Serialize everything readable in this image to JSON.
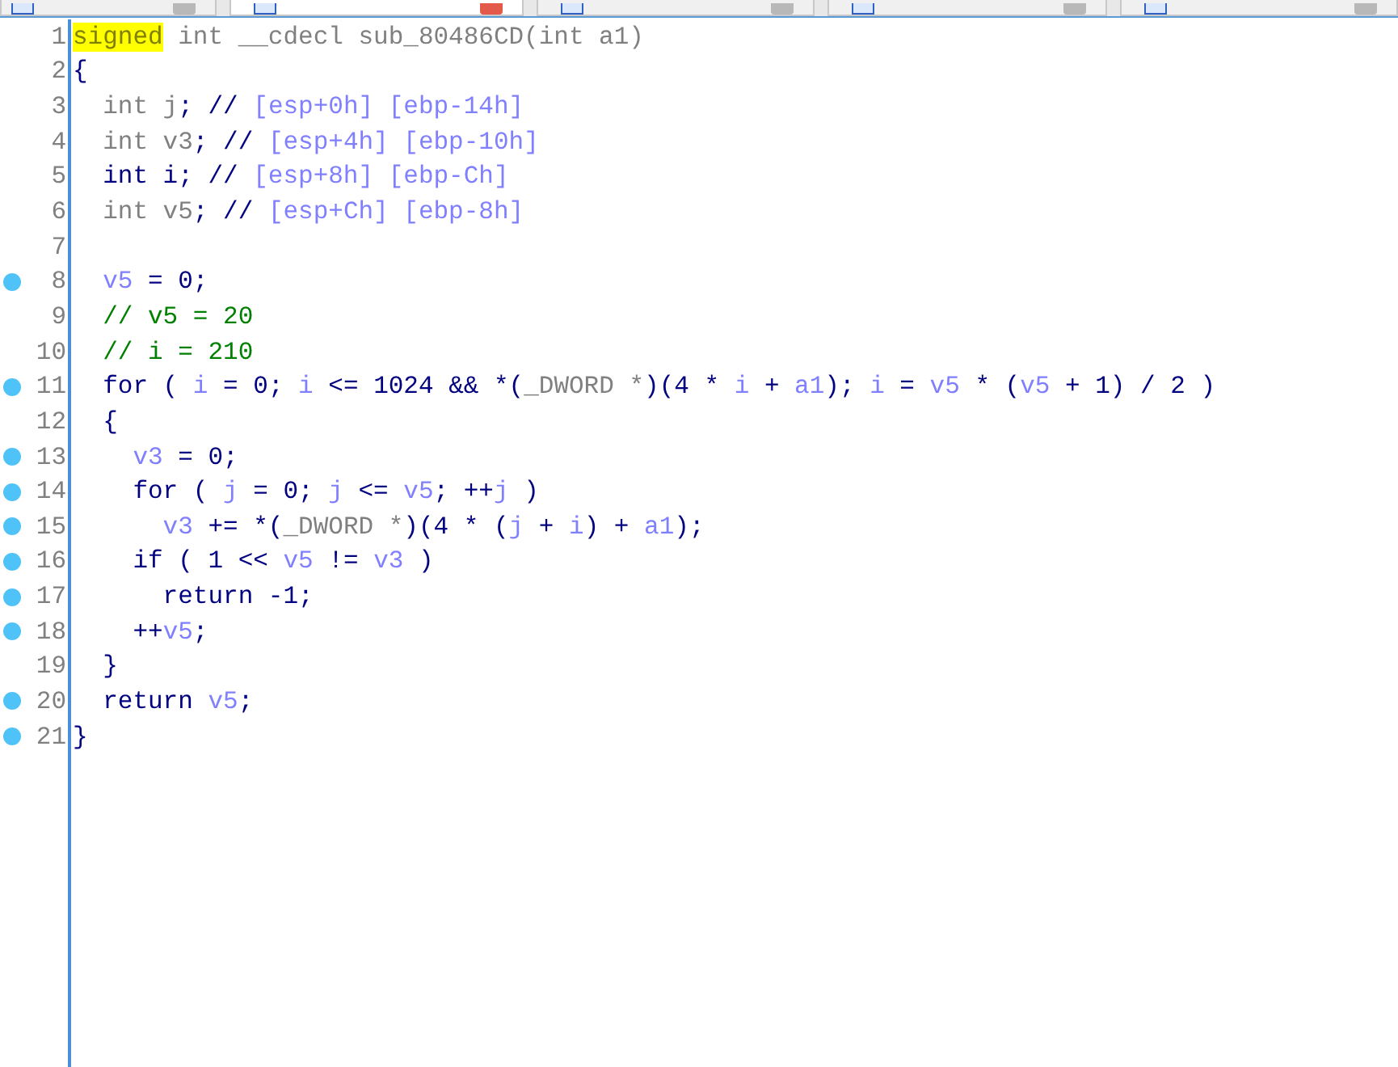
{
  "tabs": [
    {
      "selected": false
    },
    {
      "selected": true
    },
    {
      "selected": false
    },
    {
      "selected": false
    },
    {
      "selected": false
    }
  ],
  "lines": [
    {
      "number": "1",
      "breakpoint": false,
      "tokens": [
        {
          "kind": "highlight",
          "text": "signed"
        },
        {
          "kind": "dim",
          "text": " int __cdecl sub_80486CD(int a1)"
        }
      ]
    },
    {
      "number": "2",
      "breakpoint": false,
      "tokens": [
        {
          "kind": "plain",
          "text": "{"
        }
      ]
    },
    {
      "number": "3",
      "breakpoint": false,
      "tokens": [
        {
          "kind": "dim",
          "text": "  int j"
        },
        {
          "kind": "plain",
          "text": "; // "
        },
        {
          "kind": "note",
          "text": "[esp+0h] [ebp-14h]"
        }
      ]
    },
    {
      "number": "4",
      "breakpoint": false,
      "tokens": [
        {
          "kind": "dim",
          "text": "  int v3"
        },
        {
          "kind": "plain",
          "text": "; // "
        },
        {
          "kind": "note",
          "text": "[esp+4h] [ebp-10h]"
        }
      ]
    },
    {
      "number": "5",
      "breakpoint": false,
      "tokens": [
        {
          "kind": "plain",
          "text": "  int i; // "
        },
        {
          "kind": "note",
          "text": "[esp+8h] [ebp-Ch]"
        }
      ]
    },
    {
      "number": "6",
      "breakpoint": false,
      "tokens": [
        {
          "kind": "dim",
          "text": "  int v5"
        },
        {
          "kind": "plain",
          "text": "; // "
        },
        {
          "kind": "note",
          "text": "[esp+Ch] [ebp-8h]"
        }
      ]
    },
    {
      "number": "7",
      "breakpoint": false
    },
    {
      "number": "8",
      "breakpoint": true,
      "tokens": [
        {
          "kind": "var",
          "text": "  v5"
        },
        {
          "kind": "plain",
          "text": " = 0;"
        }
      ]
    },
    {
      "number": "9",
      "breakpoint": false,
      "tokens": [
        {
          "kind": "comment",
          "text": "  // v5 = 20"
        }
      ]
    },
    {
      "number": "10",
      "breakpoint": false,
      "tokens": [
        {
          "kind": "comment",
          "text": "  // i = 210"
        }
      ]
    },
    {
      "number": "11",
      "breakpoint": true,
      "tokens": [
        {
          "kind": "plain",
          "text": "  for ( "
        },
        {
          "kind": "var",
          "text": "i"
        },
        {
          "kind": "plain",
          "text": " = 0; "
        },
        {
          "kind": "var",
          "text": "i"
        },
        {
          "kind": "plain",
          "text": " <= 1024 && *("
        },
        {
          "kind": "dim",
          "text": "_DWORD *"
        },
        {
          "kind": "plain",
          "text": ")(4 * "
        },
        {
          "kind": "var",
          "text": "i"
        },
        {
          "kind": "plain",
          "text": " + "
        },
        {
          "kind": "var",
          "text": "a1"
        },
        {
          "kind": "plain",
          "text": "); "
        },
        {
          "kind": "var",
          "text": "i"
        },
        {
          "kind": "plain",
          "text": " = "
        },
        {
          "kind": "var",
          "text": "v5"
        },
        {
          "kind": "plain",
          "text": " * ("
        },
        {
          "kind": "var",
          "text": "v5"
        },
        {
          "kind": "plain",
          "text": " + 1) / 2 )"
        }
      ]
    },
    {
      "number": "12",
      "breakpoint": false,
      "tokens": [
        {
          "kind": "plain",
          "text": "  {"
        }
      ]
    },
    {
      "number": "13",
      "breakpoint": true,
      "tokens": [
        {
          "kind": "var",
          "text": "    v3"
        },
        {
          "kind": "plain",
          "text": " = 0;"
        }
      ]
    },
    {
      "number": "14",
      "breakpoint": true,
      "tokens": [
        {
          "kind": "plain",
          "text": "    for ( "
        },
        {
          "kind": "var",
          "text": "j"
        },
        {
          "kind": "plain",
          "text": " = 0; "
        },
        {
          "kind": "var",
          "text": "j"
        },
        {
          "kind": "plain",
          "text": " <= "
        },
        {
          "kind": "var",
          "text": "v5"
        },
        {
          "kind": "plain",
          "text": "; ++"
        },
        {
          "kind": "var",
          "text": "j"
        },
        {
          "kind": "plain",
          "text": " )"
        }
      ]
    },
    {
      "number": "15",
      "breakpoint": true,
      "tokens": [
        {
          "kind": "var",
          "text": "      v3"
        },
        {
          "kind": "plain",
          "text": " += *("
        },
        {
          "kind": "dim",
          "text": "_DWORD *"
        },
        {
          "kind": "plain",
          "text": ")(4 * ("
        },
        {
          "kind": "var",
          "text": "j"
        },
        {
          "kind": "plain",
          "text": " + "
        },
        {
          "kind": "var",
          "text": "i"
        },
        {
          "kind": "plain",
          "text": ") + "
        },
        {
          "kind": "var",
          "text": "a1"
        },
        {
          "kind": "plain",
          "text": ");"
        }
      ]
    },
    {
      "number": "16",
      "breakpoint": true,
      "tokens": [
        {
          "kind": "plain",
          "text": "    if ( 1 << "
        },
        {
          "kind": "var",
          "text": "v5"
        },
        {
          "kind": "plain",
          "text": " != "
        },
        {
          "kind": "var",
          "text": "v3"
        },
        {
          "kind": "plain",
          "text": " )"
        }
      ]
    },
    {
      "number": "17",
      "breakpoint": true,
      "tokens": [
        {
          "kind": "plain",
          "text": "      return -1;"
        }
      ]
    },
    {
      "number": "18",
      "breakpoint": true,
      "tokens": [
        {
          "kind": "plain",
          "text": "    ++"
        },
        {
          "kind": "var",
          "text": "v5"
        },
        {
          "kind": "plain",
          "text": ";"
        }
      ]
    },
    {
      "number": "19",
      "breakpoint": false,
      "tokens": [
        {
          "kind": "plain",
          "text": "  }"
        }
      ]
    },
    {
      "number": "20",
      "breakpoint": true,
      "tokens": [
        {
          "kind": "plain",
          "text": "  return "
        },
        {
          "kind": "var",
          "text": "v5"
        },
        {
          "kind": "plain",
          "text": ";"
        }
      ]
    },
    {
      "number": "21",
      "breakpoint": true,
      "tokens": [
        {
          "kind": "plain",
          "text": "}"
        }
      ]
    }
  ]
}
